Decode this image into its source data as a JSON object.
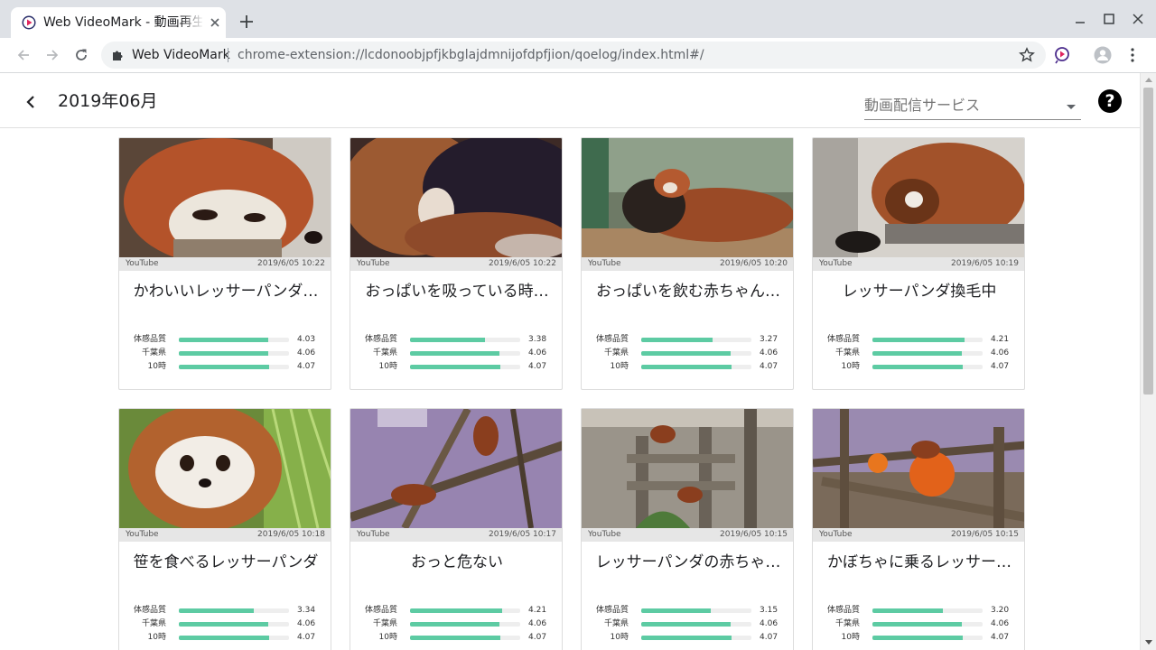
{
  "browser": {
    "tab_title": "Web VideoMark - 動画再生",
    "site_name": "Web VideoMark",
    "url": "chrome-extension://lcdonoobjpfjkbglajdmnijofdpfjion/qoelog/index.html#/"
  },
  "header": {
    "month": "2019年06月",
    "service_select": {
      "placeholder": "動画配信サービス"
    },
    "help_label": "?"
  },
  "stat_labels": [
    "体感品質",
    "千葉県",
    "10時"
  ],
  "cards": [
    {
      "service": "YouTube",
      "date": "2019/6/05 10:22",
      "title": "かわいいレッサーパンダ…",
      "stats": [
        "4.03",
        "4.06",
        "4.07"
      ],
      "fill": [
        0.81,
        0.81,
        0.82
      ]
    },
    {
      "service": "YouTube",
      "date": "2019/6/05 10:22",
      "title": "おっぱいを吸っている時…",
      "stats": [
        "3.38",
        "4.06",
        "4.07"
      ],
      "fill": [
        0.68,
        0.81,
        0.82
      ]
    },
    {
      "service": "YouTube",
      "date": "2019/6/05 10:20",
      "title": "おっぱいを飲む赤ちゃん…",
      "stats": [
        "3.27",
        "4.06",
        "4.07"
      ],
      "fill": [
        0.65,
        0.81,
        0.82
      ]
    },
    {
      "service": "YouTube",
      "date": "2019/6/05 10:19",
      "title": "レッサーパンダ換毛中",
      "stats": [
        "4.21",
        "4.06",
        "4.07"
      ],
      "fill": [
        0.84,
        0.81,
        0.82
      ]
    },
    {
      "service": "YouTube",
      "date": "2019/6/05 10:18",
      "title": "笹を食べるレッサーパンダ",
      "stats": [
        "3.34",
        "4.06",
        "4.07"
      ],
      "fill": [
        0.68,
        0.81,
        0.82
      ]
    },
    {
      "service": "YouTube",
      "date": "2019/6/05 10:17",
      "title": "おっと危ない",
      "stats": [
        "4.21",
        "4.06",
        "4.07"
      ],
      "fill": [
        0.84,
        0.81,
        0.82
      ]
    },
    {
      "service": "YouTube",
      "date": "2019/6/05 10:15",
      "title": "レッサーパンダの赤ちゃ…",
      "stats": [
        "3.15",
        "4.06",
        "4.07"
      ],
      "fill": [
        0.63,
        0.81,
        0.82
      ]
    },
    {
      "service": "YouTube",
      "date": "2019/6/05 10:15",
      "title": "かぼちゃに乗るレッサー…",
      "stats": [
        "3.20",
        "4.06",
        "4.07"
      ],
      "fill": [
        0.64,
        0.81,
        0.82
      ]
    }
  ],
  "colors": {
    "bar_fill": "#5dcba3",
    "bar_track": "#eeeeee",
    "accent": "#000000"
  }
}
